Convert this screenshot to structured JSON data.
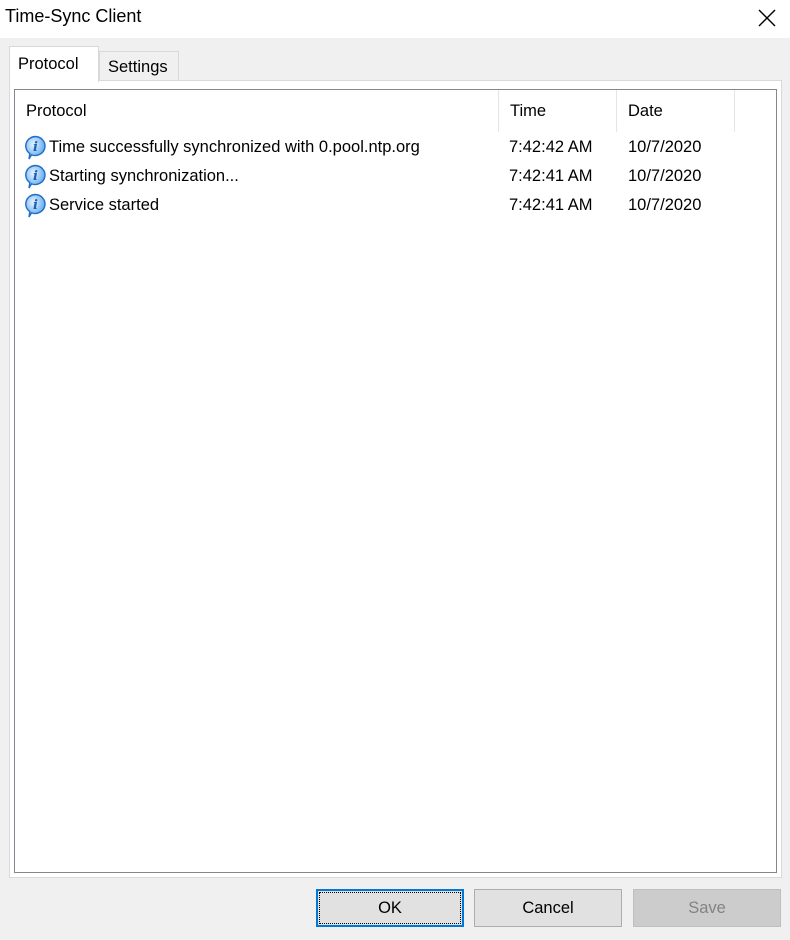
{
  "window": {
    "title": "Time-Sync Client",
    "close_icon": "close-x-icon"
  },
  "tabs": [
    {
      "label": "Protocol",
      "active": true
    },
    {
      "label": "Settings",
      "active": false
    }
  ],
  "protocol_list": {
    "columns": [
      "Protocol",
      "Time",
      "Date"
    ],
    "rows": [
      {
        "icon": "info-icon",
        "message": "Time successfully synchronized with 0.pool.ntp.org",
        "time": "7:42:42 AM",
        "date": "10/7/2020"
      },
      {
        "icon": "info-icon",
        "message": "Starting synchronization...",
        "time": "7:42:41 AM",
        "date": "10/7/2020"
      },
      {
        "icon": "info-icon",
        "message": "Service started",
        "time": "7:42:41 AM",
        "date": "10/7/2020"
      }
    ]
  },
  "buttons": {
    "ok": "OK",
    "cancel": "Cancel",
    "save": "Save",
    "save_enabled": false
  },
  "colors": {
    "focus_accent": "#0078d7",
    "info_icon": "#3a8ee6"
  }
}
